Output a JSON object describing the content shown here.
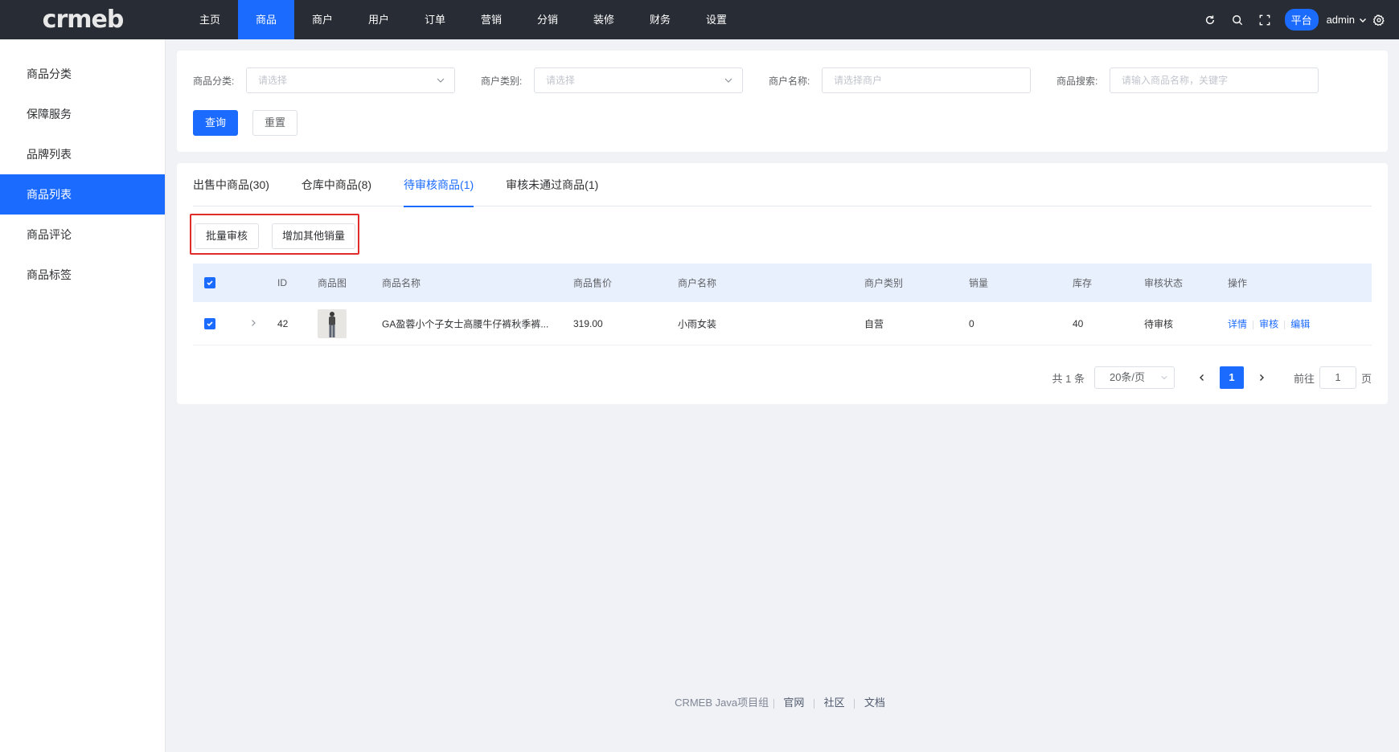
{
  "brand": {
    "logo_text": "crmeb"
  },
  "topnav": {
    "items": [
      "主页",
      "商品",
      "商户",
      "用户",
      "订单",
      "营销",
      "分销",
      "装修",
      "财务",
      "设置"
    ],
    "active_index": 1
  },
  "top_right": {
    "icons": [
      "refresh-icon",
      "search-icon",
      "fullscreen-icon",
      "settings-icon"
    ],
    "platform_badge": "平台",
    "admin_name": "admin"
  },
  "sidebar": {
    "items": [
      "商品分类",
      "保障服务",
      "品牌列表",
      "商品列表",
      "商品评论",
      "商品标签"
    ],
    "active_index": 3
  },
  "filters": {
    "category_label": "商品分类:",
    "category_placeholder": "请选择",
    "merchant_type_label": "商户类别:",
    "merchant_type_placeholder": "请选择",
    "merchant_name_label": "商户名称:",
    "merchant_name_placeholder": "请选择商户",
    "search_label": "商品搜索:",
    "search_placeholder": "请输入商品名称，关键字",
    "query_button": "查询",
    "reset_button": "重置"
  },
  "tabs": {
    "items": [
      "出售中商品(30)",
      "仓库中商品(8)",
      "待审核商品(1)",
      "审核未通过商品(1)"
    ],
    "active_index": 2
  },
  "actions": {
    "batch_audit": "批量审核",
    "add_sales": "增加其他销量"
  },
  "table": {
    "headers": {
      "id": "ID",
      "image": "商品图",
      "name": "商品名称",
      "price": "商品售价",
      "merchant": "商户名称",
      "merchant_type": "商户类别",
      "sales": "销量",
      "stock": "库存",
      "status": "审核状态",
      "ops": "操作"
    },
    "rows": [
      {
        "id": "42",
        "name": "GA盈蓉小个子女士高腰牛仔裤秋季裤...",
        "price": "319.00",
        "merchant": "小雨女装",
        "merchant_type": "自营",
        "sales": "0",
        "stock": "40",
        "status": "待审核",
        "op_detail": "详情",
        "op_audit": "审核",
        "op_edit": "编辑"
      }
    ]
  },
  "pagination": {
    "total": "共 1 条",
    "page_size": "20条/页",
    "current_page": "1",
    "goto_label": "前往",
    "goto_value": "1",
    "page_suffix": "页"
  },
  "footer": {
    "org": "CRMEB Java项目组",
    "links": [
      "官网",
      "社区",
      "文档"
    ]
  }
}
